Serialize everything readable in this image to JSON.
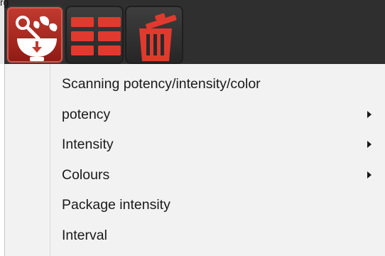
{
  "top_text": "rg",
  "toolbar": {
    "buttons": [
      {
        "name": "herbs-mortar-icon",
        "active": true
      },
      {
        "name": "grid-layout-icon",
        "active": false
      },
      {
        "name": "trash-bin-icon",
        "active": false
      }
    ]
  },
  "menu": {
    "items": [
      {
        "label": "Scanning potency/intensity/color",
        "has_submenu": false
      },
      {
        "label": "potency",
        "has_submenu": true
      },
      {
        "label": "Intensity",
        "has_submenu": true
      },
      {
        "label": "Colours",
        "has_submenu": true
      },
      {
        "label": "Package intensity",
        "has_submenu": false
      },
      {
        "label": "Interval",
        "has_submenu": false
      }
    ]
  },
  "colors": {
    "accent_red": "#c0392b",
    "toolbar_dark": "#2f2f2f",
    "menu_bg": "#f2f2f2"
  }
}
